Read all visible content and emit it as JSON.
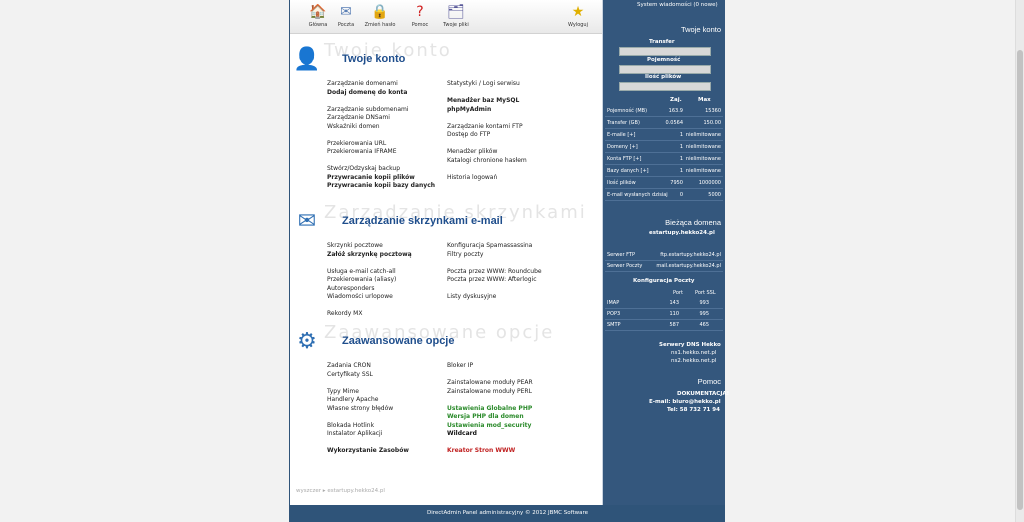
{
  "toolbar": [
    {
      "label": "Główna",
      "icon": "home-icon",
      "glyph": "🏠"
    },
    {
      "label": "Poczta",
      "icon": "mail-icon",
      "glyph": "✉"
    },
    {
      "label": "Zmień hasło",
      "icon": "lock-icon",
      "glyph": "🔒"
    },
    {
      "label": "Pomoc",
      "icon": "help-icon",
      "glyph": "?"
    },
    {
      "label": "Twoje pliki",
      "icon": "files-icon",
      "glyph": "🗂"
    },
    {
      "label": "Wyloguj",
      "icon": "logout-icon",
      "glyph": "★"
    }
  ],
  "sections": [
    {
      "title": "Twoje konto",
      "ghost": "Twoje konto",
      "icon": "account-icon",
      "left": [
        [
          "Zarządzanie domenami",
          ""
        ],
        [
          "Dodaj domenę do konta",
          "b"
        ],
        [
          "",
          ""
        ],
        [
          "Zarządzanie subdomenami",
          ""
        ],
        [
          "Zarządzanie DNSami",
          ""
        ],
        [
          "Wskaźniki domen",
          ""
        ],
        [
          "",
          ""
        ],
        [
          "Przekierowania URL",
          ""
        ],
        [
          "Przekierowania IFRAME",
          ""
        ],
        [
          "",
          ""
        ],
        [
          "Stwórz/Odzyskaj backup",
          ""
        ],
        [
          "Przywracanie kopii plików",
          "b"
        ],
        [
          "Przywracanie kopii bazy danych",
          "b"
        ]
      ],
      "right": [
        [
          "Statystyki / Logi serwisu",
          ""
        ],
        [
          "",
          ""
        ],
        [
          "Menadżer baz MySQL",
          "b"
        ],
        [
          "phpMyAdmin",
          "b"
        ],
        [
          "",
          ""
        ],
        [
          "Zarządzanie kontami FTP",
          ""
        ],
        [
          "Dostęp do FTP",
          ""
        ],
        [
          "",
          ""
        ],
        [
          "Menadżer plików",
          ""
        ],
        [
          "Katalogi chronione hasłem",
          ""
        ],
        [
          "",
          ""
        ],
        [
          "Historia logowań",
          ""
        ]
      ]
    },
    {
      "title": "Zarządzanie skrzynkami e-mail",
      "ghost": "Zarządzanie skrzynkami",
      "icon": "email-icon",
      "left": [
        [
          "Skrzynki pocztowe",
          ""
        ],
        [
          "Załóż skrzynkę pocztową",
          "b"
        ],
        [
          "",
          ""
        ],
        [
          "Usługa e-mail catch-all",
          ""
        ],
        [
          "Przekierowania (aliasy)",
          ""
        ],
        [
          "Autoresponders",
          ""
        ],
        [
          "Wiadomości urlopowe",
          ""
        ],
        [
          "",
          ""
        ],
        [
          "Rekordy MX",
          ""
        ]
      ],
      "right": [
        [
          "Konfiguracja Spamassassina",
          ""
        ],
        [
          "Filtry poczty",
          ""
        ],
        [
          "",
          ""
        ],
        [
          "Poczta przez WWW: Roundcube",
          ""
        ],
        [
          "Poczta przez WWW: Afterlogic",
          ""
        ],
        [
          "",
          ""
        ],
        [
          "Listy dyskusyjne",
          ""
        ]
      ]
    },
    {
      "title": "Zaawansowane opcje",
      "ghost": "Zaawansowane opcje",
      "icon": "advanced-icon",
      "left": [
        [
          "Zadania CRON",
          ""
        ],
        [
          "Certyfikaty SSL",
          ""
        ],
        [
          "",
          ""
        ],
        [
          "Typy Mime",
          ""
        ],
        [
          "Handlery Apache",
          ""
        ],
        [
          "Własne strony błędów",
          ""
        ],
        [
          "",
          ""
        ],
        [
          "Blokada Hotlink",
          ""
        ],
        [
          "Instalator Aplikacji",
          ""
        ],
        [
          "",
          ""
        ],
        [
          "Wykorzystanie Zasobów",
          "b"
        ]
      ],
      "right": [
        [
          "Bloker IP",
          ""
        ],
        [
          "",
          ""
        ],
        [
          "Zainstalowane moduły PEAR",
          ""
        ],
        [
          "Zainstalowane moduły PERL",
          ""
        ],
        [
          "",
          ""
        ],
        [
          "Ustawienia Globalne PHP",
          "g"
        ],
        [
          "Wersja PHP dla domen",
          "g"
        ],
        [
          "Ustawienia mod_security",
          "g"
        ],
        [
          "Wildcard",
          "k"
        ],
        [
          "",
          ""
        ],
        [
          "Kreator Stron WWW",
          "r"
        ]
      ]
    }
  ],
  "breadcrumb": "wyszczer ▸ estartupy.hekko24.pl",
  "sidebar": {
    "system_messages": "System wiadomości (0 nowe)",
    "account_title": "Twoje konto",
    "transfer_label": "Transfer",
    "capacity_label": "Pojemność",
    "files_label": "Ilość plików",
    "col_used": "Zaj.",
    "col_max": "Max",
    "usage_rows": [
      [
        "Pojemność (MB)",
        "163.9",
        "15360"
      ],
      [
        "Transfer (GB)",
        "0.0564",
        "150.00"
      ],
      [
        "E-maile [+]",
        "1",
        "nielimitowane"
      ],
      [
        "Domeny [+]",
        "1",
        "nielimitowane"
      ],
      [
        "Konta FTP [+]",
        "1",
        "nielimitowane"
      ],
      [
        "Bazy danych [+]",
        "1",
        "nielimitowane"
      ],
      [
        "Ilość plików",
        "7950",
        "1000000"
      ],
      [
        "E-mail wysłanych dzisiaj",
        "0",
        "5000"
      ]
    ],
    "current_domain_title": "Bieżąca domena",
    "current_domain": "estartupy.hekko24.pl",
    "servers": [
      [
        "Serwer FTP",
        "ftp.estartupy.hekko24.pl"
      ],
      [
        "Serwer Poczty",
        "mail.estartupy.hekko24.pl"
      ]
    ],
    "mail_config_title": "Konfiguracja Poczty",
    "port_label": "Port",
    "ssl_port_label": "Port SSL",
    "mail_ports": [
      [
        "IMAP",
        "143",
        "993"
      ],
      [
        "POP3",
        "110",
        "995"
      ],
      [
        "SMTP",
        "587",
        "465"
      ]
    ],
    "dns_title": "Serwery DNS Hekko",
    "dns": [
      "ns1.hekko.net.pl",
      "ns2.hekko.net.pl"
    ],
    "help_title": "Pomoc",
    "doc_label": "DOKUMENTACJA!",
    "email_line": "E-mail: biuro@hekko.pl",
    "phone_line": "Tel: 58 732 71 94"
  },
  "footer": "DirectAdmin Panel administracyjny © 2012 JBMC Software"
}
